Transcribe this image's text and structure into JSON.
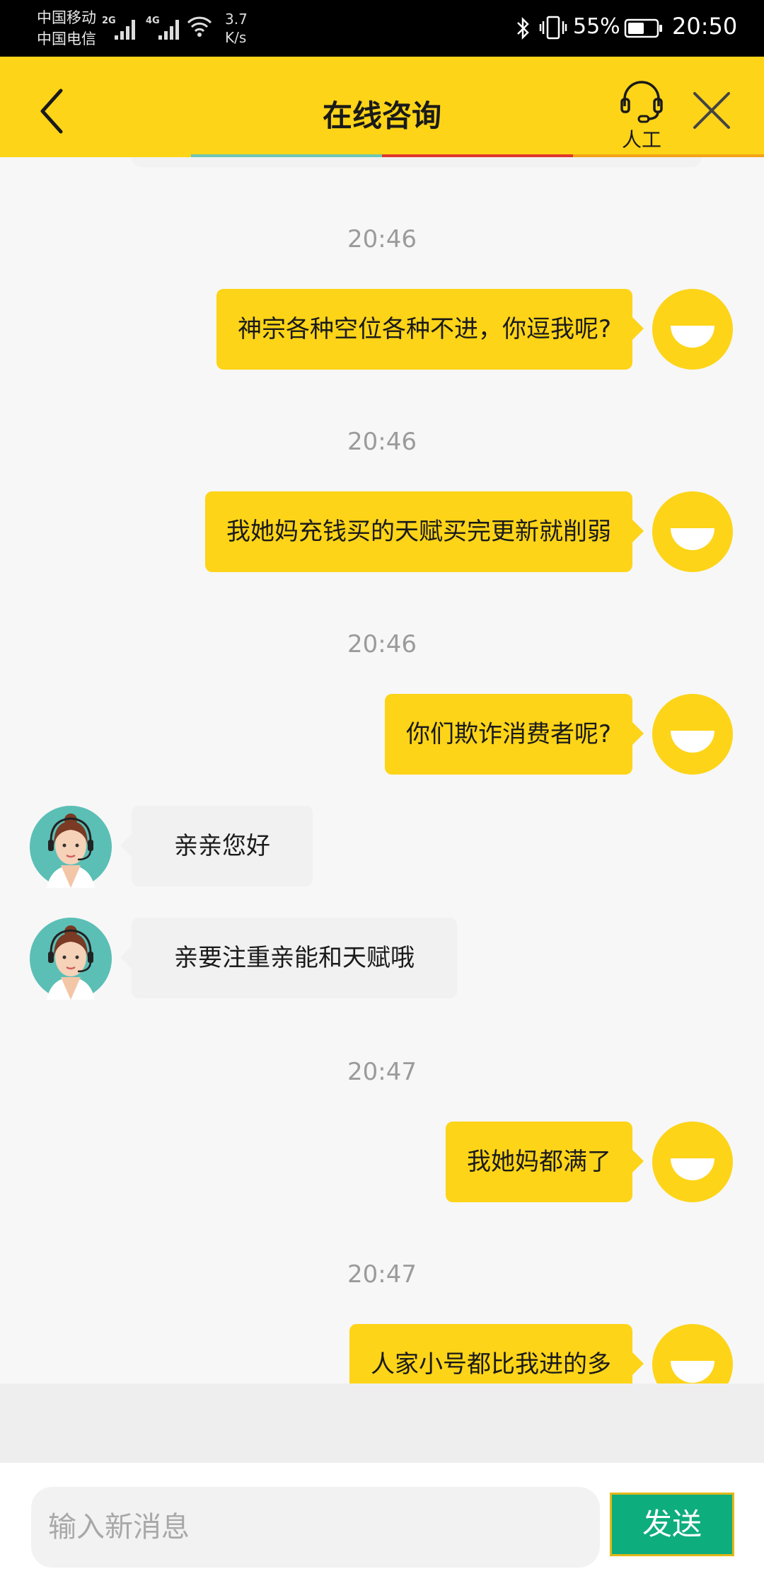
{
  "status_bar": {
    "carrier_1": "中国移动",
    "carrier_2": "中国电信",
    "network_1": "2G",
    "network_2": "4G",
    "speed_value": "3.7",
    "speed_unit": "K/s",
    "battery_percent": "55%",
    "time": "20:50"
  },
  "header": {
    "title": "在线咨询",
    "human_label": "人工",
    "back_icon": "chevron-left-icon",
    "human_icon": "headset-icon",
    "close_icon": "close-icon"
  },
  "messages": [
    {
      "type": "timestamp",
      "text": "20:46"
    },
    {
      "type": "out",
      "text": "神宗各种空位各种不进，你逗我呢?"
    },
    {
      "type": "timestamp",
      "text": "20:46"
    },
    {
      "type": "out",
      "text": "我她妈充钱买的天赋买完更新就削弱"
    },
    {
      "type": "timestamp",
      "text": "20:46"
    },
    {
      "type": "out",
      "text": "你们欺诈消费者呢?"
    },
    {
      "type": "in",
      "text": "亲亲您好"
    },
    {
      "type": "in",
      "text": "亲要注重亲能和天赋哦"
    },
    {
      "type": "timestamp",
      "text": "20:47"
    },
    {
      "type": "out",
      "text": "我她妈都满了"
    },
    {
      "type": "timestamp",
      "text": "20:47"
    },
    {
      "type": "out",
      "text": "人家小号都比我进的多"
    }
  ],
  "composer": {
    "placeholder": "输入新消息",
    "value": "",
    "send_label": "发送"
  },
  "colors": {
    "brand_yellow": "#fdd418",
    "send_green": "#0ead7e",
    "agent_bubble": "#f1f1f1",
    "timestamp_gray": "#9b9b9b"
  }
}
